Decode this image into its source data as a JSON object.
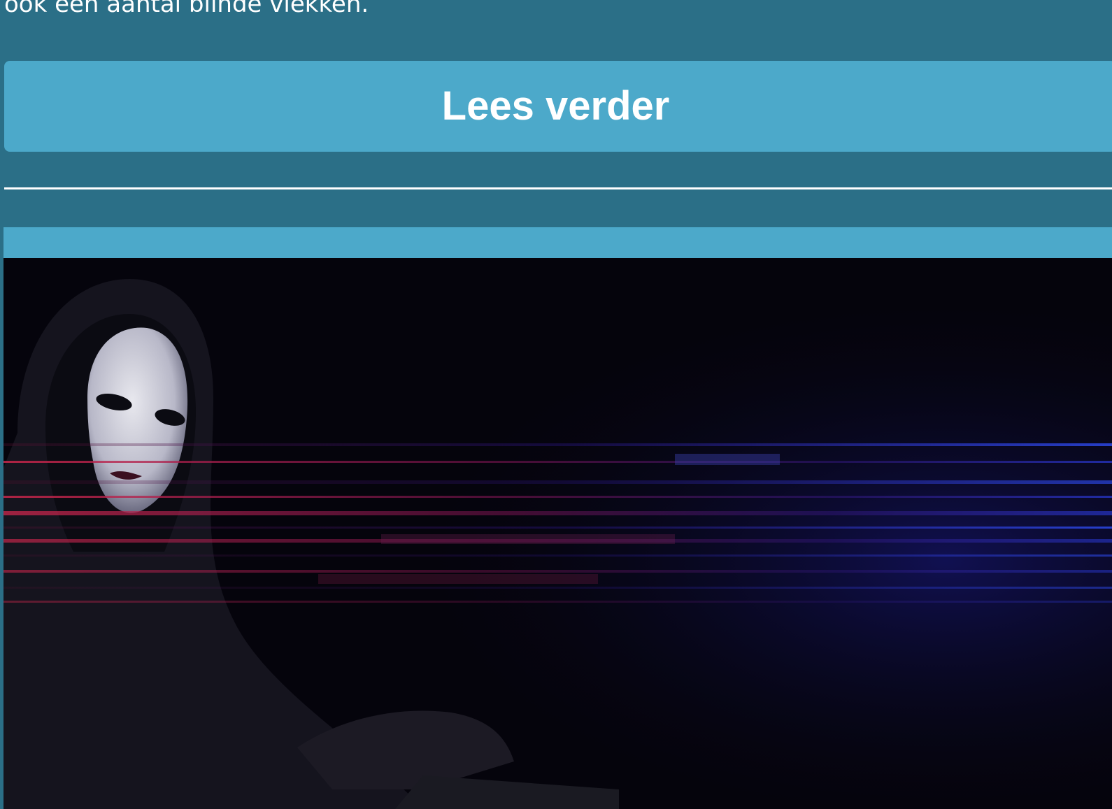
{
  "article": {
    "intro_text": "ook een aantal blinde vlekken."
  },
  "actions": {
    "read_more_label": "Lees verder"
  },
  "next_article": {
    "image_subject": "masked-hacker-photo"
  },
  "colors": {
    "page_background": "#2b6f87",
    "button_background": "#4ca9ca",
    "button_text": "#ffffff",
    "divider": "#ffffff",
    "image_background": "#05040c"
  }
}
